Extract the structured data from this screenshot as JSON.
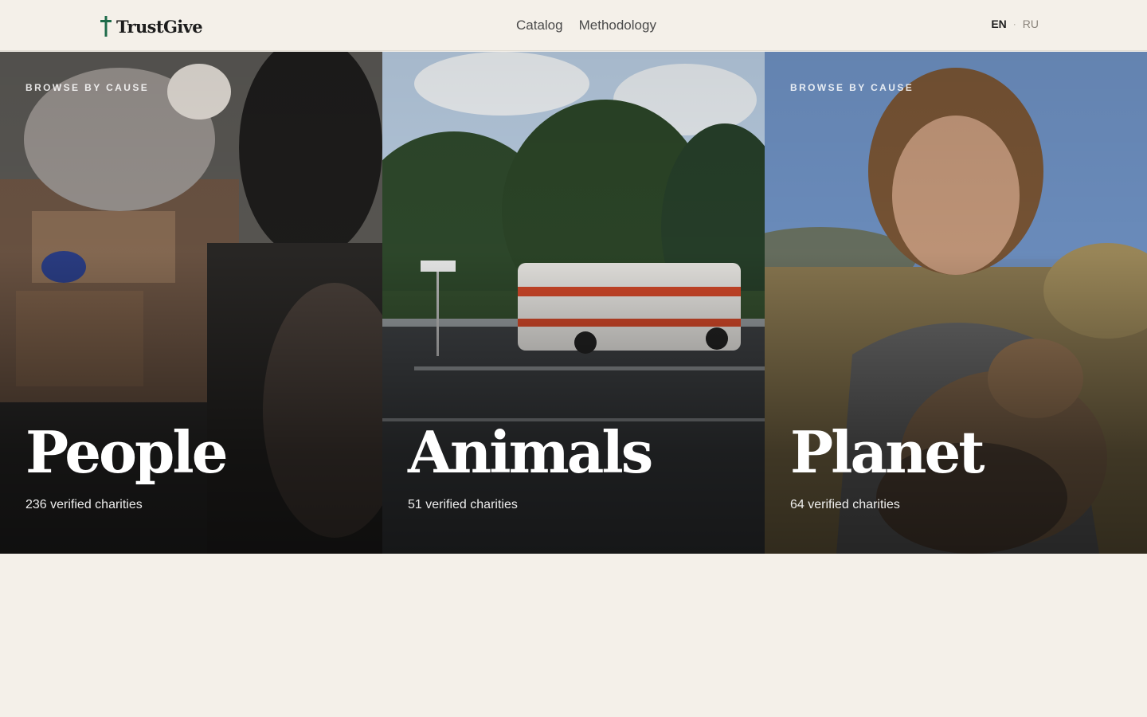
{
  "header": {
    "logo_text": "TrustGive",
    "nav": [
      {
        "label": "Catalog"
      },
      {
        "label": "Methodology"
      }
    ],
    "languages": {
      "active": "EN",
      "separator": "·",
      "other": "RU"
    }
  },
  "causes": [
    {
      "eyebrow": "BROWSE BY CAUSE",
      "title": "People",
      "count": "236 verified charities"
    },
    {
      "eyebrow": "",
      "title": "Animals",
      "count": "51 verified charities"
    },
    {
      "eyebrow": "BROWSE BY CAUSE",
      "title": "Planet",
      "count": "64 verified charities"
    }
  ],
  "colors": {
    "background": "#f4f0e9",
    "logo_mark": "#1e6b4a",
    "text": "#1f1f1f",
    "nav_text": "#4a4a4a"
  },
  "icons": {
    "logo_mark": "cross-icon"
  }
}
